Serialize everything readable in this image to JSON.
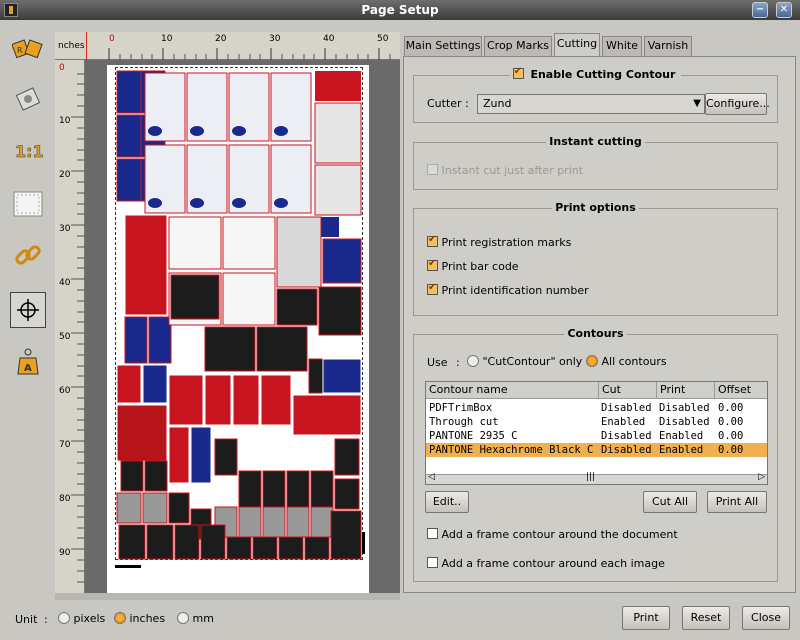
{
  "window": {
    "title": "Page Setup"
  },
  "ruler": {
    "unit_label": "nches",
    "h_ticks": [
      "0",
      "10",
      "20",
      "30",
      "40",
      "50"
    ],
    "v_ticks": [
      "0",
      "10",
      "20",
      "30",
      "40",
      "50",
      "60",
      "70",
      "80",
      "90"
    ]
  },
  "tabs": [
    "Main Settings",
    "Crop Marks",
    "Cutting",
    "White",
    "Varnish"
  ],
  "active_tab": "Cutting",
  "cutting": {
    "enable_label": "Enable Cutting Contour",
    "enable_checked": true,
    "cutter_label": "Cutter",
    "cutter_sep": ":",
    "cutter_value": "Zund",
    "configure_label": "Configure..."
  },
  "instant": {
    "title": "Instant cutting",
    "label": "Instant cut just after print",
    "checked": false,
    "enabled": false
  },
  "print_options": {
    "title": "Print options",
    "items": [
      {
        "label": "Print registration marks",
        "checked": true
      },
      {
        "label": "Print bar code",
        "checked": true
      },
      {
        "label": "Print identification number",
        "checked": true
      }
    ]
  },
  "contours": {
    "title": "Contours",
    "use_label": "Use",
    "use_sep": ":",
    "options": [
      {
        "label": "\"CutContour\" only",
        "selected": false
      },
      {
        "label": "All contours",
        "selected": true
      }
    ],
    "columns": [
      "Contour name",
      "Cut",
      "Print",
      "Offset"
    ],
    "rows": [
      {
        "name": "PDFTrimBox",
        "cut": "Disabled",
        "print": "Disabled",
        "offset": "0.00"
      },
      {
        "name": "Through cut",
        "cut": "Enabled",
        "print": "Disabled",
        "offset": "0.00"
      },
      {
        "name": "PANTONE 2935 C",
        "cut": "Disabled",
        "print": "Enabled",
        "offset": "0.00"
      },
      {
        "name": "PANTONE Hexachrome Black C",
        "cut": "Disabled",
        "print": "Enabled",
        "offset": "0.00",
        "selected": true
      }
    ],
    "edit_label": "Edit..",
    "cut_all_label": "Cut All",
    "print_all_label": "Print All",
    "frame_doc_label": "Add a frame contour around the document",
    "frame_doc_checked": false,
    "frame_img_label": "Add a frame contour around each image",
    "frame_img_checked": false
  },
  "unit": {
    "label": "Unit",
    "sep": ":",
    "options": [
      {
        "label": "pixels",
        "selected": false
      },
      {
        "label": "inches",
        "selected": true
      },
      {
        "label": "mm",
        "selected": false
      }
    ]
  },
  "footer": {
    "print_label": "Print",
    "reset_label": "Reset",
    "close_label": "Close"
  },
  "colors": {
    "accent": "#f0b050",
    "brand_red": "#c8141e",
    "brand_blue": "#1a2a8c"
  }
}
